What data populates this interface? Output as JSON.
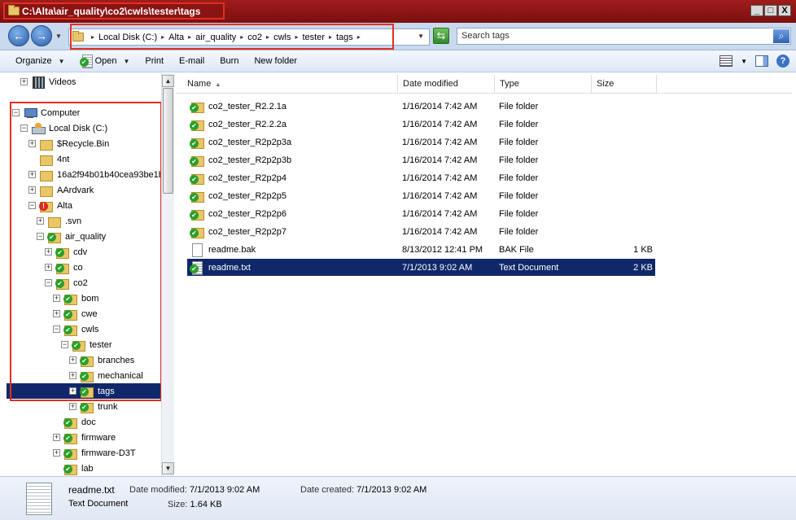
{
  "window": {
    "title": "C:\\Alta\\air_quality\\co2\\cwls\\tester\\tags",
    "buttons": [
      "_",
      "□",
      "X"
    ]
  },
  "address": {
    "back_glyph": "←",
    "forward_glyph": "→",
    "breadcrumbs": [
      "Local Disk (C:)",
      "Alta",
      "air_quality",
      "co2",
      "cwls",
      "tester",
      "tags"
    ],
    "search_placeholder": "Search tags"
  },
  "toolbar": {
    "organize": "Organize",
    "open": "Open",
    "print": "Print",
    "email": "E-mail",
    "burn": "Burn",
    "new_folder": "New folder"
  },
  "tree": {
    "items": [
      {
        "label": "Videos",
        "expander": "+",
        "icon": "video"
      },
      {
        "label": "Computer",
        "expander": "−",
        "icon": "computer"
      },
      {
        "label": "Local Disk (C:)",
        "expander": "−",
        "icon": "disk"
      },
      {
        "label": "$Recycle.Bin",
        "expander": "+",
        "icon": "folder"
      },
      {
        "label": "4nt",
        "expander": "",
        "icon": "folder"
      },
      {
        "label": "16a2f94b01b40cea93be1b",
        "expander": "+",
        "icon": "folder"
      },
      {
        "label": "AArdvark",
        "expander": "+",
        "icon": "folder"
      },
      {
        "label": "Alta",
        "expander": "−",
        "icon": "svnerr"
      },
      {
        "label": ".svn",
        "expander": "+",
        "icon": "folder"
      },
      {
        "label": "air_quality",
        "expander": "−",
        "icon": "svnok"
      },
      {
        "label": "cdv",
        "expander": "+",
        "icon": "svnok"
      },
      {
        "label": "co",
        "expander": "+",
        "icon": "svnok"
      },
      {
        "label": "co2",
        "expander": "−",
        "icon": "svnok"
      },
      {
        "label": "bom",
        "expander": "+",
        "icon": "svnok"
      },
      {
        "label": "cwe",
        "expander": "+",
        "icon": "svnok"
      },
      {
        "label": "cwls",
        "expander": "−",
        "icon": "svnok"
      },
      {
        "label": "tester",
        "expander": "−",
        "icon": "svnok"
      },
      {
        "label": "branches",
        "expander": "+",
        "icon": "svnok"
      },
      {
        "label": "mechanical",
        "expander": "+",
        "icon": "svnok"
      },
      {
        "label": "tags",
        "expander": "+",
        "icon": "svnok",
        "selected": true
      },
      {
        "label": "trunk",
        "expander": "+",
        "icon": "svnok"
      },
      {
        "label": "doc",
        "expander": "",
        "icon": "svnok"
      },
      {
        "label": "firmware",
        "expander": "+",
        "icon": "svnok"
      },
      {
        "label": "firmware-D3T",
        "expander": "+",
        "icon": "svnok"
      },
      {
        "label": "lab",
        "expander": "",
        "icon": "svnok"
      }
    ]
  },
  "columns": {
    "name": "Name",
    "date": "Date modified",
    "type": "Type",
    "size": "Size"
  },
  "files": [
    {
      "name": "co2_tester_R2.2.1a",
      "date": "1/16/2014 7:42 AM",
      "type": "File folder",
      "size": "",
      "icon": "folder"
    },
    {
      "name": "co2_tester_R2.2.2a",
      "date": "1/16/2014 7:42 AM",
      "type": "File folder",
      "size": "",
      "icon": "folder"
    },
    {
      "name": "co2_tester_R2p2p3a",
      "date": "1/16/2014 7:42 AM",
      "type": "File folder",
      "size": "",
      "icon": "folder"
    },
    {
      "name": "co2_tester_R2p2p3b",
      "date": "1/16/2014 7:42 AM",
      "type": "File folder",
      "size": "",
      "icon": "folder"
    },
    {
      "name": "co2_tester_R2p2p4",
      "date": "1/16/2014 7:42 AM",
      "type": "File folder",
      "size": "",
      "icon": "folder"
    },
    {
      "name": "co2_tester_R2p2p5",
      "date": "1/16/2014 7:42 AM",
      "type": "File folder",
      "size": "",
      "icon": "folder"
    },
    {
      "name": "co2_tester_R2p2p6",
      "date": "1/16/2014 7:42 AM",
      "type": "File folder",
      "size": "",
      "icon": "folder"
    },
    {
      "name": "co2_tester_R2p2p7",
      "date": "1/16/2014 7:42 AM",
      "type": "File folder",
      "size": "",
      "icon": "folder"
    },
    {
      "name": "readme.bak",
      "date": "8/13/2012 12:41 PM",
      "type": "BAK File",
      "size": "1 KB",
      "icon": "file"
    },
    {
      "name": "readme.txt",
      "date": "7/1/2013 9:02 AM",
      "type": "Text Document",
      "size": "2 KB",
      "icon": "txtok",
      "selected": true
    }
  ],
  "details": {
    "filename": "readme.txt",
    "filetype": "Text Document",
    "modified_label": "Date modified:",
    "modified_value": "7/1/2013 9:02 AM",
    "created_label": "Date created:",
    "created_value": "7/1/2013 9:02 AM",
    "size_label": "Size:",
    "size_value": "1.64 KB"
  }
}
